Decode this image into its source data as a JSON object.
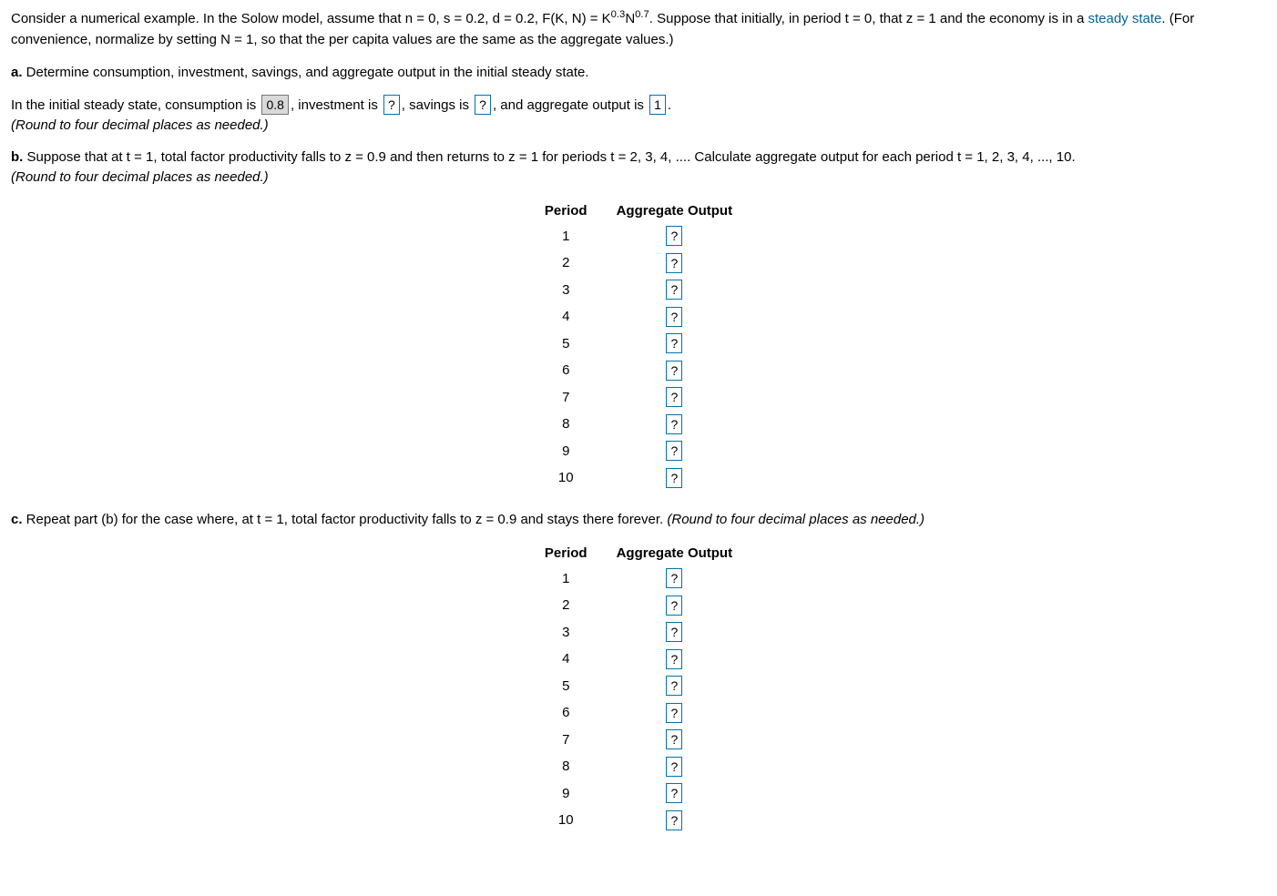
{
  "intro": {
    "part1": "Consider a numerical example. In the Solow model, assume that n = 0, s = 0.2, d = 0.2, F(K, N) = K",
    "sup1": "0.3",
    "mid": "N",
    "sup2": "0.7",
    "part2": ". Suppose that initially, in period t = 0, that z = 1 and the economy is in a ",
    "steady_link": "steady state",
    "part3": ". (For convenience, normalize by setting N = 1, so that the per capita values are the same as the aggregate values.)"
  },
  "partA": {
    "label": "a.",
    "prompt": " Determine consumption, investment, savings, and aggregate output in the initial steady state.",
    "sentence_pre": "In the initial steady state, consumption is ",
    "consumption": "0.8",
    "after_c": ", investment is ",
    "investment": "?",
    "after_i": ", savings is ",
    "savings": "?",
    "after_s": ", and aggregate output is ",
    "output": "1",
    "period": ".",
    "round_note": "(Round to four decimal places as needed.)"
  },
  "partB": {
    "label": "b.",
    "prompt": " Suppose that at t = 1, total factor productivity falls to z = 0.9 and then returns to z = 1 for periods t = 2, 3, 4, .... Calculate aggregate output for each period t = 1, 2, 3, 4, ..., 10.",
    "round_note": "(Round to four decimal places as needed.)",
    "header_period": "Period",
    "header_output": "Aggregate Output",
    "rows": [
      {
        "period": "1",
        "value": "?"
      },
      {
        "period": "2",
        "value": "?"
      },
      {
        "period": "3",
        "value": "?"
      },
      {
        "period": "4",
        "value": "?"
      },
      {
        "period": "5",
        "value": "?"
      },
      {
        "period": "6",
        "value": "?"
      },
      {
        "period": "7",
        "value": "?"
      },
      {
        "period": "8",
        "value": "?"
      },
      {
        "period": "9",
        "value": "?"
      },
      {
        "period": "10",
        "value": "?"
      }
    ]
  },
  "partC": {
    "label": "c.",
    "prompt": " Repeat part (b) for the case where, at t = 1, total factor productivity falls to z = 0.9 and stays there forever. ",
    "round_note": "(Round to four decimal places as needed.)",
    "header_period": "Period",
    "header_output": "Aggregate Output",
    "rows": [
      {
        "period": "1",
        "value": "?"
      },
      {
        "period": "2",
        "value": "?"
      },
      {
        "period": "3",
        "value": "?"
      },
      {
        "period": "4",
        "value": "?"
      },
      {
        "period": "5",
        "value": "?"
      },
      {
        "period": "6",
        "value": "?"
      },
      {
        "period": "7",
        "value": "?"
      },
      {
        "period": "8",
        "value": "?"
      },
      {
        "period": "9",
        "value": "?"
      },
      {
        "period": "10",
        "value": "?"
      }
    ]
  }
}
